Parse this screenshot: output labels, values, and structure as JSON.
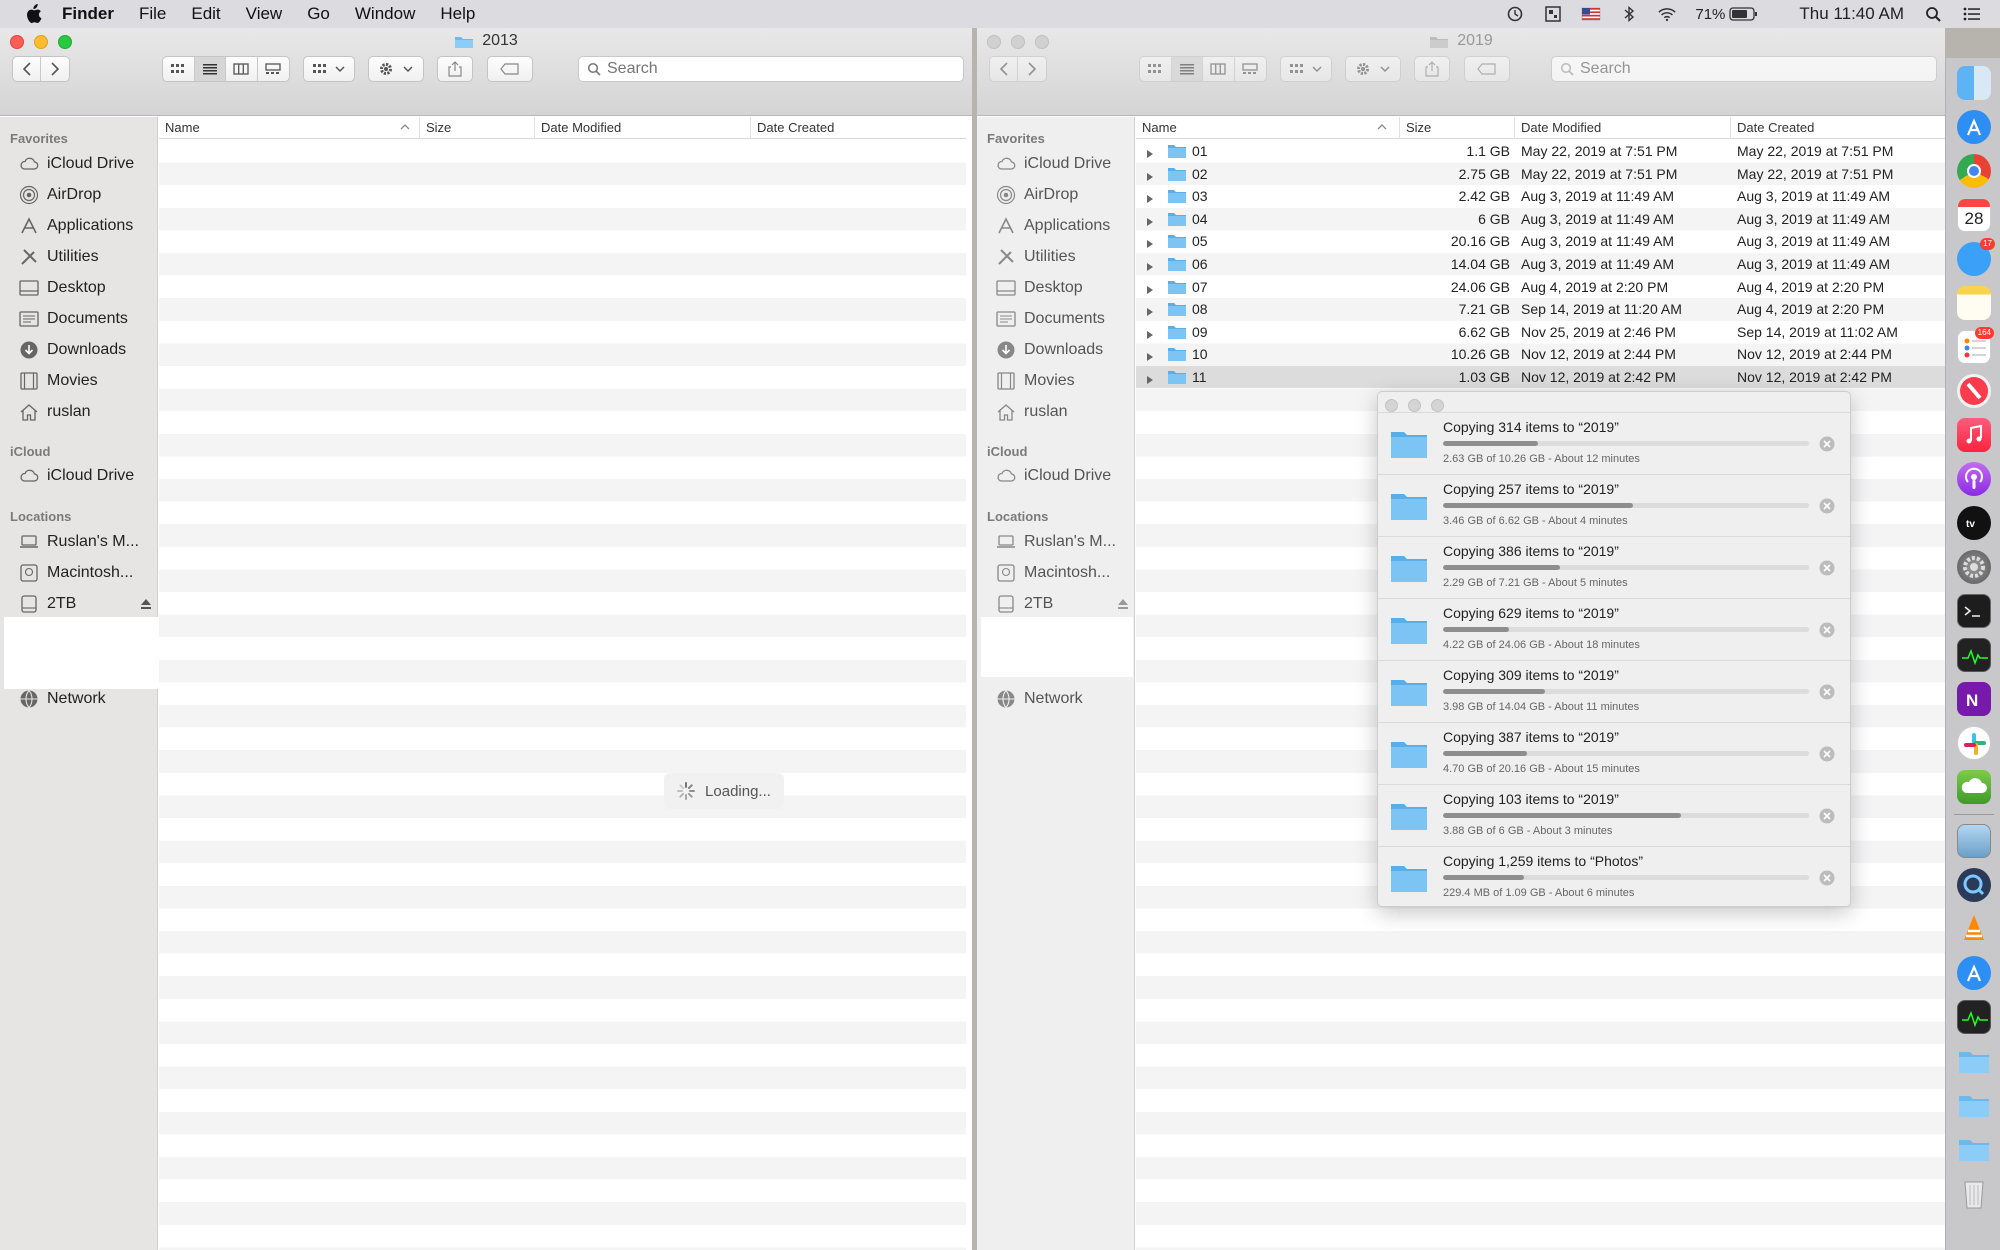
{
  "menubar": {
    "app": "Finder",
    "menus": [
      "File",
      "Edit",
      "View",
      "Go",
      "Window",
      "Help"
    ],
    "battery": "71%",
    "clock": "Thu 11:40 AM"
  },
  "left_window": {
    "title": "2013",
    "search_placeholder": "Search",
    "loading": "Loading..."
  },
  "right_window": {
    "title": "2019",
    "search_placeholder": "Search"
  },
  "sidebar": {
    "favorites_label": "Favorites",
    "favorites": [
      "iCloud Drive",
      "AirDrop",
      "Applications",
      "Utilities",
      "Desktop",
      "Documents",
      "Downloads",
      "Movies",
      "ruslan"
    ],
    "icloud_label": "iCloud",
    "icloud": [
      "iCloud Drive"
    ],
    "locations_label": "Locations",
    "locations": [
      "Ruslan's M...",
      "Macintosh...",
      "2TB",
      "Network"
    ]
  },
  "columns": {
    "name": "Name",
    "size": "Size",
    "modified": "Date Modified",
    "created": "Date Created"
  },
  "files": [
    {
      "name": "01",
      "size": "1.1 GB",
      "modified": "May 22, 2019 at 7:51 PM",
      "created": "May 22, 2019 at 7:51 PM"
    },
    {
      "name": "02",
      "size": "2.75 GB",
      "modified": "May 22, 2019 at 7:51 PM",
      "created": "May 22, 2019 at 7:51 PM"
    },
    {
      "name": "03",
      "size": "2.42 GB",
      "modified": "Aug 3, 2019 at 11:49 AM",
      "created": "Aug 3, 2019 at 11:49 AM"
    },
    {
      "name": "04",
      "size": "6 GB",
      "modified": "Aug 3, 2019 at 11:49 AM",
      "created": "Aug 3, 2019 at 11:49 AM"
    },
    {
      "name": "05",
      "size": "20.16 GB",
      "modified": "Aug 3, 2019 at 11:49 AM",
      "created": "Aug 3, 2019 at 11:49 AM"
    },
    {
      "name": "06",
      "size": "14.04 GB",
      "modified": "Aug 3, 2019 at 11:49 AM",
      "created": "Aug 3, 2019 at 11:49 AM"
    },
    {
      "name": "07",
      "size": "24.06 GB",
      "modified": "Aug 4, 2019 at 2:20 PM",
      "created": "Aug 4, 2019 at 2:20 PM"
    },
    {
      "name": "08",
      "size": "7.21 GB",
      "modified": "Sep 14, 2019 at 11:20 AM",
      "created": "Aug 4, 2019 at 2:20 PM"
    },
    {
      "name": "09",
      "size": "6.62 GB",
      "modified": "Nov 25, 2019 at 2:46 PM",
      "created": "Sep 14, 2019 at 11:02 AM"
    },
    {
      "name": "10",
      "size": "10.26 GB",
      "modified": "Nov 12, 2019 at 2:44 PM",
      "created": "Nov 12, 2019 at 2:44 PM"
    },
    {
      "name": "11",
      "size": "1.03 GB",
      "modified": "Nov 12, 2019 at 2:42 PM",
      "created": "Nov 12, 2019 at 2:42 PM"
    }
  ],
  "copy_jobs": [
    {
      "title": "Copying 314 items to “2019”",
      "status": "2.63 GB of 10.26 GB - About 12 minutes",
      "progress": 0.26
    },
    {
      "title": "Copying 257 items to “2019”",
      "status": "3.46 GB of 6.62 GB - About 4 minutes",
      "progress": 0.52
    },
    {
      "title": "Copying 386 items to “2019”",
      "status": "2.29 GB of 7.21 GB - About 5 minutes",
      "progress": 0.32
    },
    {
      "title": "Copying 629 items to “2019”",
      "status": "4.22 GB of 24.06 GB - About 18 minutes",
      "progress": 0.18
    },
    {
      "title": "Copying 309 items to “2019”",
      "status": "3.98 GB of 14.04 GB - About 11 minutes",
      "progress": 0.28
    },
    {
      "title": "Copying 387 items to “2019”",
      "status": "4.70 GB of 20.16 GB - About 15 minutes",
      "progress": 0.23
    },
    {
      "title": "Copying 103 items to “2019”",
      "status": "3.88 GB of 6 GB - About 3 minutes",
      "progress": 0.65
    },
    {
      "title": "Copying 1,259 items to “Photos”",
      "status": "229.4 MB of 1.09 GB - About 6 minutes",
      "progress": 0.22
    }
  ],
  "dock": {
    "calendar_day": "28",
    "messages_badge": "17",
    "reminders_badge": "164"
  }
}
